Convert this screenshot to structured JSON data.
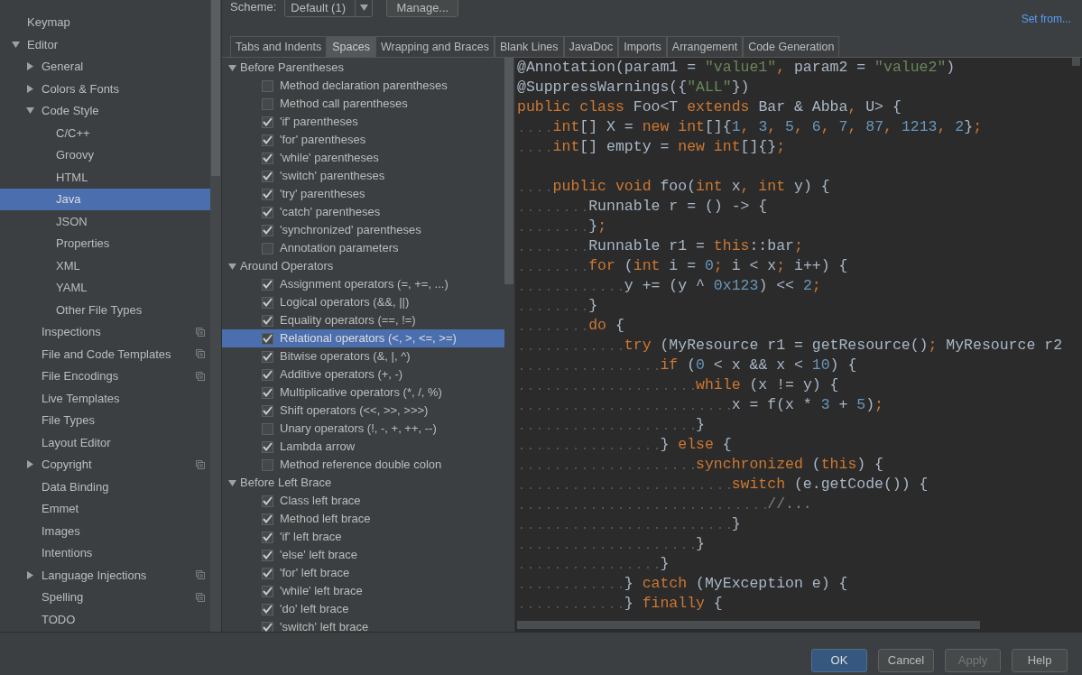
{
  "sidebar": {
    "items": [
      {
        "label": "Keymap",
        "selected": false,
        "project_icon": false
      },
      {
        "label": "Editor",
        "expanded": true,
        "selected": false,
        "project_icon": false,
        "children": [
          {
            "label": "General",
            "expanded": false,
            "selected": false,
            "project_icon": false
          },
          {
            "label": "Colors & Fonts",
            "expanded": false,
            "selected": false,
            "project_icon": false
          },
          {
            "label": "Code Style",
            "expanded": true,
            "selected": false,
            "project_icon": false,
            "children": [
              {
                "label": "C/C++",
                "selected": false,
                "project_icon": false
              },
              {
                "label": "Groovy",
                "selected": false,
                "project_icon": false
              },
              {
                "label": "HTML",
                "selected": false,
                "project_icon": false
              },
              {
                "label": "Java",
                "selected": true,
                "project_icon": false
              },
              {
                "label": "JSON",
                "selected": false,
                "project_icon": false
              },
              {
                "label": "Properties",
                "selected": false,
                "project_icon": false
              },
              {
                "label": "XML",
                "selected": false,
                "project_icon": false
              },
              {
                "label": "YAML",
                "selected": false,
                "project_icon": false
              },
              {
                "label": "Other File Types",
                "selected": false,
                "project_icon": false
              }
            ]
          },
          {
            "label": "Inspections",
            "selected": false,
            "project_icon": true
          },
          {
            "label": "File and Code Templates",
            "selected": false,
            "project_icon": true
          },
          {
            "label": "File Encodings",
            "selected": false,
            "project_icon": true
          },
          {
            "label": "Live Templates",
            "selected": false,
            "project_icon": false
          },
          {
            "label": "File Types",
            "selected": false,
            "project_icon": false
          },
          {
            "label": "Layout Editor",
            "selected": false,
            "project_icon": false
          },
          {
            "label": "Copyright",
            "expanded": false,
            "selected": false,
            "project_icon": true
          },
          {
            "label": "Data Binding",
            "selected": false,
            "project_icon": false
          },
          {
            "label": "Emmet",
            "selected": false,
            "project_icon": false
          },
          {
            "label": "Images",
            "selected": false,
            "project_icon": false
          },
          {
            "label": "Intentions",
            "selected": false,
            "project_icon": false
          },
          {
            "label": "Language Injections",
            "expanded": false,
            "selected": false,
            "project_icon": true
          },
          {
            "label": "Spelling",
            "selected": false,
            "project_icon": true
          },
          {
            "label": "TODO",
            "selected": false,
            "project_icon": false
          }
        ]
      }
    ]
  },
  "header": {
    "scheme_label": "Scheme:",
    "scheme_value": "Default (1)",
    "manage_button": "Manage...",
    "set_from_link": "Set from..."
  },
  "tabs": [
    {
      "label": "Tabs and Indents",
      "selected": false
    },
    {
      "label": "Spaces",
      "selected": true
    },
    {
      "label": "Wrapping and Braces",
      "selected": false
    },
    {
      "label": "Blank Lines",
      "selected": false
    },
    {
      "label": "JavaDoc",
      "selected": false
    },
    {
      "label": "Imports",
      "selected": false
    },
    {
      "label": "Arrangement",
      "selected": false
    },
    {
      "label": "Code Generation",
      "selected": false
    }
  ],
  "option_groups": [
    {
      "label": "Before Parentheses",
      "expanded": true,
      "options": [
        {
          "label": "Method declaration parentheses",
          "checked": false,
          "selected": false
        },
        {
          "label": "Method call parentheses",
          "checked": false,
          "selected": false
        },
        {
          "label": "'if' parentheses",
          "checked": true,
          "selected": false
        },
        {
          "label": "'for' parentheses",
          "checked": true,
          "selected": false
        },
        {
          "label": "'while' parentheses",
          "checked": true,
          "selected": false
        },
        {
          "label": "'switch' parentheses",
          "checked": true,
          "selected": false
        },
        {
          "label": "'try' parentheses",
          "checked": true,
          "selected": false
        },
        {
          "label": "'catch' parentheses",
          "checked": true,
          "selected": false
        },
        {
          "label": "'synchronized' parentheses",
          "checked": true,
          "selected": false
        },
        {
          "label": "Annotation parameters",
          "checked": false,
          "selected": false
        }
      ]
    },
    {
      "label": "Around Operators",
      "expanded": true,
      "options": [
        {
          "label": "Assignment operators (=, +=, ...)",
          "checked": true,
          "selected": false
        },
        {
          "label": "Logical operators (&&, ||)",
          "checked": true,
          "selected": false
        },
        {
          "label": "Equality operators (==, !=)",
          "checked": true,
          "selected": false
        },
        {
          "label": "Relational operators (<, >, <=, >=)",
          "checked": true,
          "selected": true
        },
        {
          "label": "Bitwise operators (&, |, ^)",
          "checked": true,
          "selected": false
        },
        {
          "label": "Additive operators (+, -)",
          "checked": true,
          "selected": false
        },
        {
          "label": "Multiplicative operators (*, /, %)",
          "checked": true,
          "selected": false
        },
        {
          "label": "Shift operators (<<, >>, >>>)",
          "checked": true,
          "selected": false
        },
        {
          "label": "Unary operators (!, -, +, ++, --)",
          "checked": false,
          "selected": false
        },
        {
          "label": "Lambda arrow",
          "checked": true,
          "selected": false
        },
        {
          "label": "Method reference double colon",
          "checked": false,
          "selected": false
        }
      ]
    },
    {
      "label": "Before Left Brace",
      "expanded": true,
      "options": [
        {
          "label": "Class left brace",
          "checked": true,
          "selected": false
        },
        {
          "label": "Method left brace",
          "checked": true,
          "selected": false
        },
        {
          "label": "'if' left brace",
          "checked": true,
          "selected": false
        },
        {
          "label": "'else' left brace",
          "checked": true,
          "selected": false
        },
        {
          "label": "'for' left brace",
          "checked": true,
          "selected": false
        },
        {
          "label": "'while' left brace",
          "checked": true,
          "selected": false
        },
        {
          "label": "'do' left brace",
          "checked": true,
          "selected": false
        },
        {
          "label": "'switch' left brace",
          "checked": true,
          "selected": false
        }
      ]
    }
  ],
  "code_blocks": [
    {
      "lines": [
        {
          "tokens": [
            {
              "kind": "plain",
              "text": "@Annotation(param1 = "
            },
            {
              "kind": "string",
              "text": "\"value1\""
            },
            {
              "kind": "keyword",
              "text": ", "
            },
            {
              "kind": "plain",
              "text": "param2 = "
            },
            {
              "kind": "string",
              "text": "\"value2\""
            },
            {
              "kind": "plain",
              "text": ")"
            }
          ]
        },
        {
          "tokens": [
            {
              "kind": "plain",
              "text": "@SuppressWarnings({"
            },
            {
              "kind": "string",
              "text": "\"ALL\""
            },
            {
              "kind": "plain",
              "text": "})"
            }
          ]
        },
        {
          "tokens": [
            {
              "kind": "keyword",
              "text": "public class "
            },
            {
              "kind": "plain",
              "text": "Foo<T "
            },
            {
              "kind": "keyword",
              "text": "extends "
            },
            {
              "kind": "plain",
              "text": "Bar & Abba"
            },
            {
              "kind": "keyword",
              "text": ", "
            },
            {
              "kind": "plain",
              "text": "U> {"
            }
          ]
        },
        {
          "tokens": [
            {
              "kind": "keyword",
              "text": "    int"
            },
            {
              "kind": "plain",
              "text": "[] X = "
            },
            {
              "kind": "keyword",
              "text": "new int"
            },
            {
              "kind": "plain",
              "text": "[]{"
            },
            {
              "kind": "number",
              "text": "1"
            },
            {
              "kind": "keyword",
              "text": ", "
            },
            {
              "kind": "number",
              "text": "3"
            },
            {
              "kind": "keyword",
              "text": ", "
            },
            {
              "kind": "number",
              "text": "5"
            },
            {
              "kind": "keyword",
              "text": ", "
            },
            {
              "kind": "number",
              "text": "6"
            },
            {
              "kind": "keyword",
              "text": ", "
            },
            {
              "kind": "number",
              "text": "7"
            },
            {
              "kind": "keyword",
              "text": ", "
            },
            {
              "kind": "number",
              "text": "87"
            },
            {
              "kind": "keyword",
              "text": ", "
            },
            {
              "kind": "number",
              "text": "1213"
            },
            {
              "kind": "keyword",
              "text": ", "
            },
            {
              "kind": "number",
              "text": "2"
            },
            {
              "kind": "plain",
              "text": "}"
            },
            {
              "kind": "keyword",
              "text": ";"
            }
          ]
        },
        {
          "tokens": [
            {
              "kind": "keyword",
              "text": "    int"
            },
            {
              "kind": "plain",
              "text": "[] empty = "
            },
            {
              "kind": "keyword",
              "text": "new int"
            },
            {
              "kind": "plain",
              "text": "[]{}"
            },
            {
              "kind": "keyword",
              "text": ";"
            }
          ]
        }
      ]
    },
    {
      "lines": [
        {
          "tokens": [
            {
              "kind": "keyword",
              "text": "    public void "
            },
            {
              "kind": "plain",
              "text": "foo("
            },
            {
              "kind": "keyword",
              "text": "int "
            },
            {
              "kind": "plain",
              "text": "x"
            },
            {
              "kind": "keyword",
              "text": ", int "
            },
            {
              "kind": "plain",
              "text": "y) {"
            }
          ]
        },
        {
          "tokens": [
            {
              "kind": "plain",
              "text": "        Runnable r = () -> {"
            }
          ]
        },
        {
          "tokens": [
            {
              "kind": "plain",
              "text": "        }"
            },
            {
              "kind": "keyword",
              "text": ";"
            }
          ]
        },
        {
          "tokens": [
            {
              "kind": "plain",
              "text": "        Runnable r1 = "
            },
            {
              "kind": "keyword",
              "text": "this"
            },
            {
              "kind": "plain",
              "text": "::bar"
            },
            {
              "kind": "keyword",
              "text": ";"
            }
          ]
        },
        {
          "tokens": [
            {
              "kind": "keyword",
              "text": "        for "
            },
            {
              "kind": "plain",
              "text": "("
            },
            {
              "kind": "keyword",
              "text": "int "
            },
            {
              "kind": "plain",
              "text": "i = "
            },
            {
              "kind": "number",
              "text": "0"
            },
            {
              "kind": "keyword",
              "text": "; "
            },
            {
              "kind": "plain",
              "text": "i < x"
            },
            {
              "kind": "keyword",
              "text": "; "
            },
            {
              "kind": "plain",
              "text": "i++) {"
            }
          ]
        },
        {
          "tokens": [
            {
              "kind": "plain",
              "text": "            y += (y ^ "
            },
            {
              "kind": "number",
              "text": "0x123"
            },
            {
              "kind": "plain",
              "text": ") << "
            },
            {
              "kind": "number",
              "text": "2"
            },
            {
              "kind": "keyword",
              "text": ";"
            }
          ]
        },
        {
          "tokens": [
            {
              "kind": "plain",
              "text": "        }"
            }
          ]
        },
        {
          "tokens": [
            {
              "kind": "keyword",
              "text": "        do "
            },
            {
              "kind": "plain",
              "text": "{"
            }
          ]
        },
        {
          "tokens": [
            {
              "kind": "keyword",
              "text": "            try "
            },
            {
              "kind": "plain",
              "text": "(MyResource r1 = getResource()"
            },
            {
              "kind": "keyword",
              "text": "; "
            },
            {
              "kind": "plain",
              "text": "MyResource r2"
            }
          ]
        },
        {
          "tokens": [
            {
              "kind": "keyword",
              "text": "                if "
            },
            {
              "kind": "plain",
              "text": "("
            },
            {
              "kind": "number",
              "text": "0"
            },
            {
              "kind": "plain",
              "text": " < x && x < "
            },
            {
              "kind": "number",
              "text": "10"
            },
            {
              "kind": "plain",
              "text": ") {"
            }
          ]
        },
        {
          "tokens": [
            {
              "kind": "keyword",
              "text": "                    while "
            },
            {
              "kind": "plain",
              "text": "(x != y) {"
            }
          ]
        },
        {
          "tokens": [
            {
              "kind": "plain",
              "text": "                        x = f(x * "
            },
            {
              "kind": "number",
              "text": "3"
            },
            {
              "kind": "plain",
              "text": " + "
            },
            {
              "kind": "number",
              "text": "5"
            },
            {
              "kind": "plain",
              "text": ")"
            },
            {
              "kind": "keyword",
              "text": ";"
            }
          ]
        },
        {
          "tokens": [
            {
              "kind": "plain",
              "text": "                    }"
            }
          ]
        },
        {
          "tokens": [
            {
              "kind": "plain",
              "text": "                } "
            },
            {
              "kind": "keyword",
              "text": "else "
            },
            {
              "kind": "plain",
              "text": "{"
            }
          ]
        },
        {
          "tokens": [
            {
              "kind": "keyword",
              "text": "                    synchronized "
            },
            {
              "kind": "plain",
              "text": "("
            },
            {
              "kind": "keyword",
              "text": "this"
            },
            {
              "kind": "plain",
              "text": ") {"
            }
          ]
        },
        {
          "tokens": [
            {
              "kind": "keyword",
              "text": "                        switch "
            },
            {
              "kind": "plain",
              "text": "(e.getCode()) {"
            }
          ]
        },
        {
          "tokens": [
            {
              "kind": "comment",
              "text": "                            //..."
            }
          ]
        },
        {
          "tokens": [
            {
              "kind": "plain",
              "text": "                        }"
            }
          ]
        },
        {
          "tokens": [
            {
              "kind": "plain",
              "text": "                    }"
            }
          ]
        },
        {
          "tokens": [
            {
              "kind": "plain",
              "text": "                }"
            }
          ]
        },
        {
          "tokens": [
            {
              "kind": "plain",
              "text": "            } "
            },
            {
              "kind": "keyword",
              "text": "catch "
            },
            {
              "kind": "plain",
              "text": "(MyException e) {"
            }
          ]
        },
        {
          "tokens": [
            {
              "kind": "plain",
              "text": "            } "
            },
            {
              "kind": "keyword",
              "text": "finally "
            },
            {
              "kind": "plain",
              "text": "{"
            }
          ]
        }
      ]
    }
  ],
  "buttons": [
    {
      "label": "OK",
      "default": true,
      "disabled": false
    },
    {
      "label": "Cancel",
      "default": false,
      "disabled": false
    },
    {
      "label": "Apply",
      "default": false,
      "disabled": true
    },
    {
      "label": "Help",
      "default": false,
      "disabled": false
    }
  ]
}
